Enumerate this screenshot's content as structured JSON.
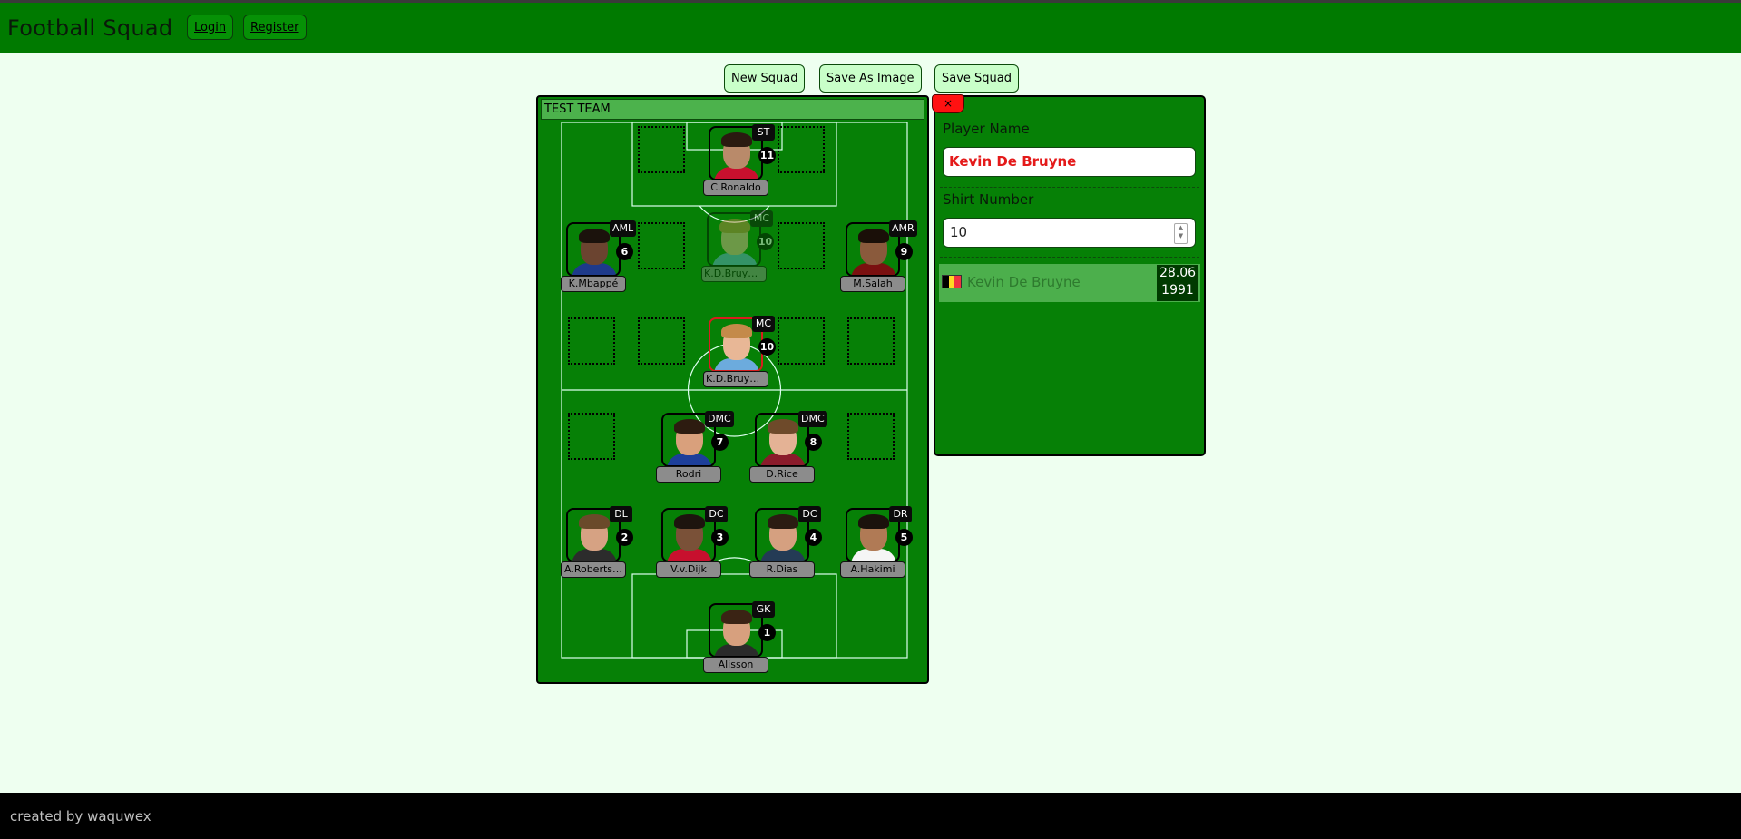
{
  "header": {
    "title": "Football Squad",
    "login_label": "Login",
    "register_label": "Register"
  },
  "actions": {
    "new_squad": "New Squad",
    "save_as_image": "Save As Image",
    "save_squad": "Save Squad"
  },
  "team": {
    "name": "TEST TEAM",
    "players": [
      {
        "id": "st",
        "name": "C.Ronaldo",
        "position": "ST",
        "number": "11",
        "skin": "#b98a6a",
        "hair": "#2a1a10",
        "shirt": "#c8102e"
      },
      {
        "id": "aml",
        "name": "K.Mbappé",
        "position": "AML",
        "number": "6",
        "skin": "#6b4430",
        "hair": "#1b120c",
        "shirt": "#1e3a8a"
      },
      {
        "id": "mc-ghost",
        "name": "K.D.Bruyn…",
        "position": "MC",
        "number": "10",
        "skin": "#e8b796",
        "hair": "#c48a4a",
        "shirt": "#6cabdd",
        "ghost": true
      },
      {
        "id": "amr",
        "name": "M.Salah",
        "position": "AMR",
        "number": "9",
        "skin": "#8a5a3c",
        "hair": "#1a0f08",
        "shirt": "#7a1010"
      },
      {
        "id": "mc",
        "name": "K.D.Bruyn…",
        "position": "MC",
        "number": "10",
        "skin": "#e8b796",
        "hair": "#c48a4a",
        "shirt": "#6cabdd",
        "selected": true
      },
      {
        "id": "dmc-left",
        "name": "Rodri",
        "position": "DMC",
        "number": "7",
        "skin": "#d9a07c",
        "hair": "#2d1b10",
        "shirt": "#1d3f9a"
      },
      {
        "id": "dmc-right",
        "name": "D.Rice",
        "position": "DMC",
        "number": "8",
        "skin": "#e4b295",
        "hair": "#6e4a2a",
        "shirt": "#8a1b2b"
      },
      {
        "id": "dl",
        "name": "A.Roberts…",
        "position": "DL",
        "number": "2",
        "skin": "#d6a283",
        "hair": "#6a4a2a",
        "shirt": "#2c2c2c"
      },
      {
        "id": "dc-left",
        "name": "V.v.Dijk",
        "position": "DC",
        "number": "3",
        "skin": "#7a5138",
        "hair": "#1d140e",
        "shirt": "#c8102e"
      },
      {
        "id": "dc-right",
        "name": "R.Dias",
        "position": "DC",
        "number": "4",
        "skin": "#d5a080",
        "hair": "#2b1c12",
        "shirt": "#243b55"
      },
      {
        "id": "dr",
        "name": "A.Hakimi",
        "position": "DR",
        "number": "5",
        "skin": "#b07a55",
        "hair": "#1b120c",
        "shirt": "#f5f5f5"
      },
      {
        "id": "gk",
        "name": "Alisson",
        "position": "GK",
        "number": "1",
        "skin": "#d7a07e",
        "hair": "#3a2314",
        "shirt": "#2b2b2b"
      }
    ]
  },
  "editor": {
    "close_label": "×",
    "name_label": "Player Name",
    "name_value": "Kevin De Bruyne",
    "number_label": "Shirt Number",
    "number_value": "10",
    "spin_up": "▲",
    "spin_down": "▼",
    "result": {
      "name": "Kevin De Bruyne",
      "date_line1": "28.06",
      "date_line2": "1991",
      "flag_colors": [
        "#000000",
        "#FDDA24",
        "#EF3340"
      ]
    }
  },
  "footer": {
    "credit": "created by waquwex"
  }
}
